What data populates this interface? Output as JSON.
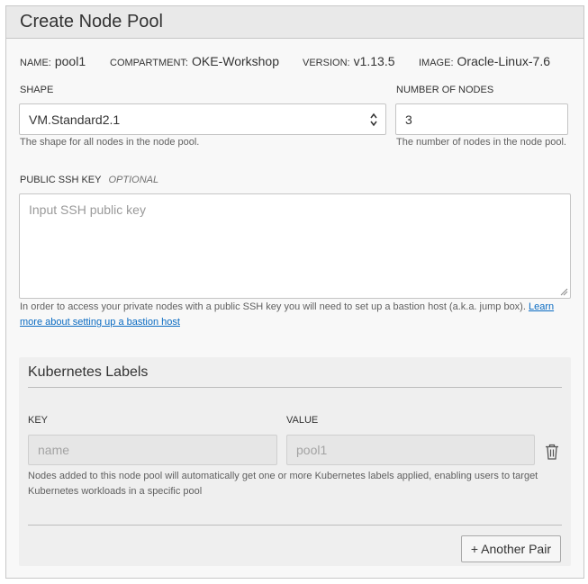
{
  "header": {
    "title": "Create Node Pool"
  },
  "meta": {
    "name_key": "NAME:",
    "name_value": "pool1",
    "compartment_key": "COMPARTMENT:",
    "compartment_value": "OKE-Workshop",
    "version_key": "VERSION:",
    "version_value": "v1.13.5",
    "image_key": "IMAGE:",
    "image_value": "Oracle-Linux-7.6"
  },
  "shape": {
    "label": "SHAPE",
    "value": "VM.Standard2.1",
    "help": "The shape for all nodes in the node pool."
  },
  "nodes": {
    "label": "NUMBER OF NODES",
    "value": "3",
    "help": "The number of nodes in the node pool."
  },
  "ssh": {
    "label": "PUBLIC SSH KEY",
    "optional": "OPTIONAL",
    "placeholder": "Input SSH public key",
    "help": "In order to access your private nodes with a public SSH key you will need to set up a bastion host (a.k.a. jump box).",
    "link_part1": "Learn",
    "link_part2": "more about setting up a bastion host"
  },
  "kube_labels": {
    "title": "Kubernetes Labels",
    "key_label": "KEY",
    "value_label": "VALUE",
    "key_placeholder": "name",
    "value_placeholder": "pool1",
    "help_line1": "Nodes added to this node pool will automatically get one or more Kubernetes labels applied, enabling users to target",
    "help_line2": "Kubernetes workloads in a specific pool",
    "add_button": "+ Another Pair"
  },
  "icons": {
    "select": "select-arrows-icon",
    "delete": "trash-icon",
    "resize": "resize-grip-icon"
  }
}
